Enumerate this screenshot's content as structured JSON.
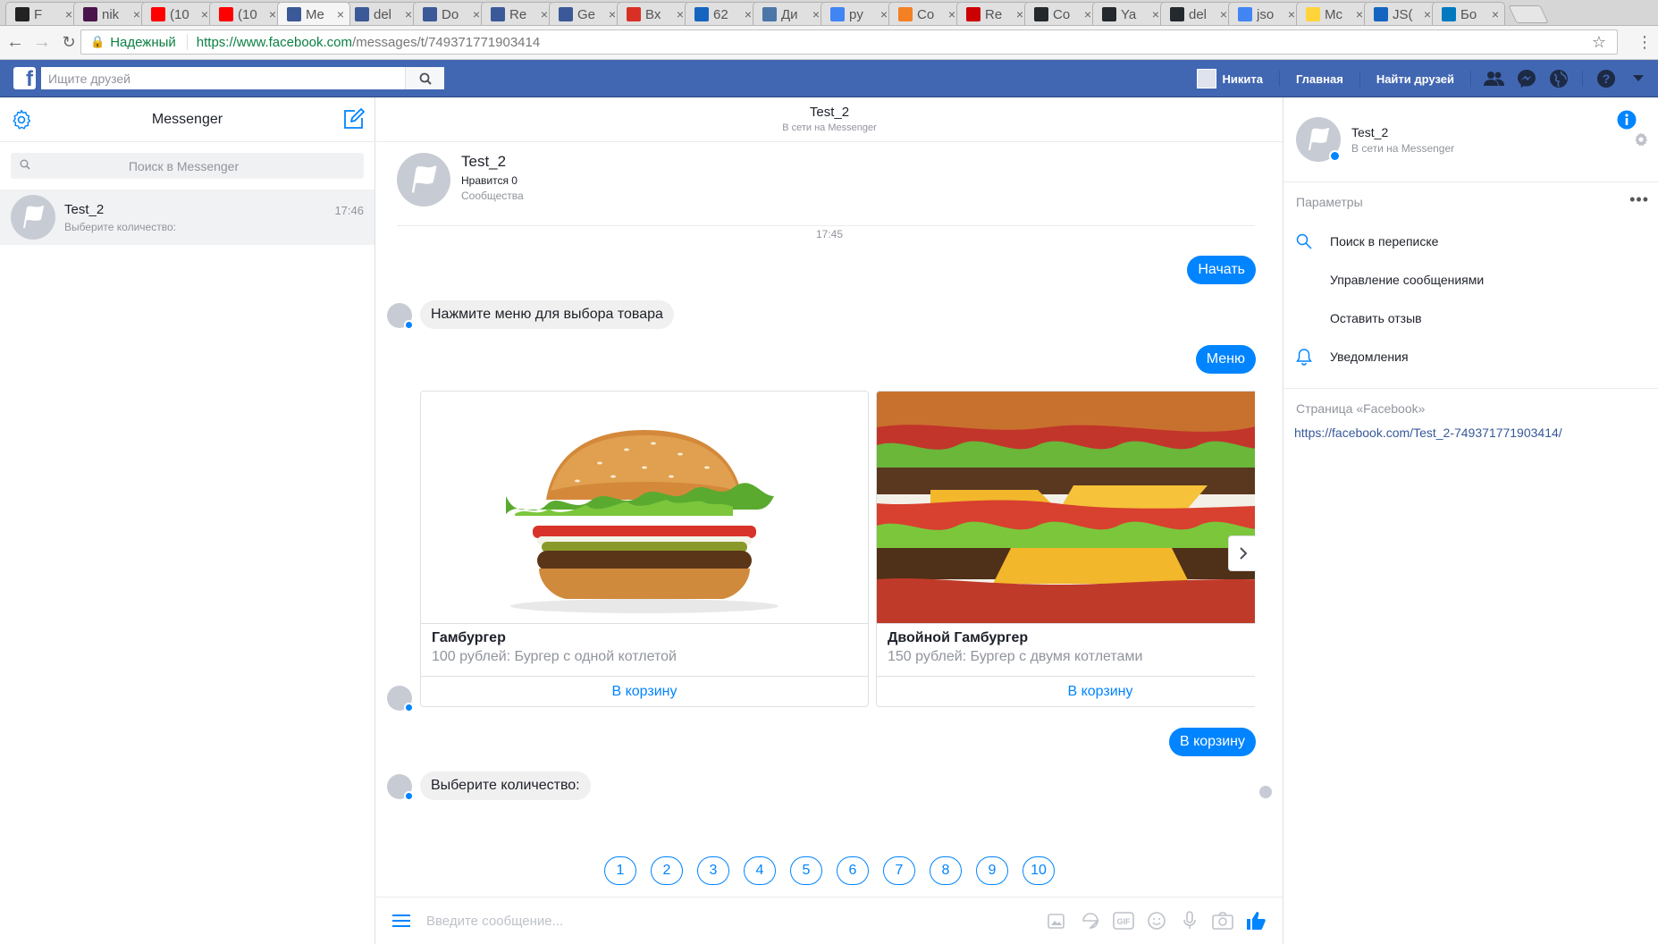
{
  "browser": {
    "tabs": [
      {
        "label": "F",
        "color": "#222222"
      },
      {
        "label": "nik",
        "color": "#4a154b"
      },
      {
        "label": "(10",
        "color": "#ff0000"
      },
      {
        "label": "(10",
        "color": "#ff0000"
      },
      {
        "label": "Me",
        "color": "#3b5998",
        "active": true
      },
      {
        "label": "del",
        "color": "#3b5998"
      },
      {
        "label": "Do",
        "color": "#3b5998"
      },
      {
        "label": "Re",
        "color": "#3b5998"
      },
      {
        "label": "Ge",
        "color": "#3b5998"
      },
      {
        "label": "Вх",
        "color": "#d93025"
      },
      {
        "label": "62",
        "color": "#1565c0"
      },
      {
        "label": "Ди",
        "color": "#4a76a8"
      },
      {
        "label": "py",
        "color": "#4285f4"
      },
      {
        "label": "Co",
        "color": "#f48024"
      },
      {
        "label": "Re",
        "color": "#cc0000"
      },
      {
        "label": "Co",
        "color": "#24292e"
      },
      {
        "label": "Ya",
        "color": "#24292e"
      },
      {
        "label": "del",
        "color": "#24292e"
      },
      {
        "label": "jso",
        "color": "#4285f4"
      },
      {
        "label": "Mc",
        "color": "#ffd43b"
      },
      {
        "label": "JS(",
        "color": "#1565c0"
      },
      {
        "label": "Бо",
        "color": "#0079bf"
      }
    ],
    "secure_label": "Надежный",
    "url_host": "https://www.facebook.com",
    "url_path": "/messages/t/749371771903414"
  },
  "fb": {
    "search_placeholder": "Ищите друзей",
    "user_name": "Никита",
    "home": "Главная",
    "find_friends": "Найти друзей"
  },
  "left": {
    "title": "Messenger",
    "search_placeholder": "Поиск в Messenger",
    "thread": {
      "name": "Test_2",
      "snippet": "Выберите количество:",
      "time": "17:46"
    }
  },
  "conversation": {
    "name": "Test_2",
    "status": "В сети на Messenger",
    "page_card": {
      "name": "Test_2",
      "likes": "Нравится 0",
      "category": "Сообщества"
    },
    "timestamp": "17:45",
    "messages": {
      "start": "Начать",
      "press_menu": "Нажмите меню для выбора товара",
      "menu": "Меню",
      "to_cart": "В корзину",
      "choose_qty": "Выберите количество:"
    },
    "cards": [
      {
        "title": "Гамбургер",
        "subtitle": "100 рублей: Бургер с одной котлетой",
        "button": "В корзину"
      },
      {
        "title": "Двойной Гамбургер",
        "subtitle": "150 рублей: Бургер с двумя котлетами",
        "button": "В корзину"
      }
    ],
    "quick_replies": [
      "1",
      "2",
      "3",
      "4",
      "5",
      "6",
      "7",
      "8",
      "9",
      "10"
    ],
    "composer_placeholder": "Введите сообщение..."
  },
  "right": {
    "name": "Test_2",
    "status": "В сети на Messenger",
    "options_title": "Параметры",
    "options": [
      "Поиск в переписке",
      "Управление сообщениями",
      "Оставить отзыв",
      "Уведомления"
    ],
    "page_title": "Страница «Facebook»",
    "page_link": "https://facebook.com/Test_2-749371771903414/"
  },
  "colors": {
    "fb_blue": "#4267b2",
    "messenger_blue": "#0084ff"
  }
}
